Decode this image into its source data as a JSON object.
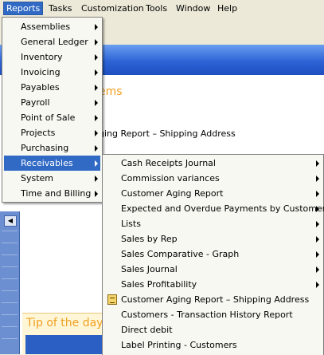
{
  "menubar": {
    "items": [
      "Reports",
      "Tasks",
      "Customization",
      "Tools",
      "Window",
      "Help"
    ],
    "active": "Reports"
  },
  "background": {
    "heading_fragment": "ems",
    "report_fragment": "ging Report – Shipping Address",
    "tip_title": "Tip of the day"
  },
  "reports_menu": {
    "items": [
      {
        "label": "Assemblies",
        "submenu": true
      },
      {
        "label": "General Ledger",
        "submenu": true
      },
      {
        "label": "Inventory",
        "submenu": true
      },
      {
        "label": "Invoicing",
        "submenu": true
      },
      {
        "label": "Payables",
        "submenu": true
      },
      {
        "label": "Payroll",
        "submenu": true
      },
      {
        "label": "Point of Sale",
        "submenu": true
      },
      {
        "label": "Projects",
        "submenu": true
      },
      {
        "label": "Purchasing",
        "submenu": true
      },
      {
        "label": "Receivables",
        "submenu": true,
        "highlighted": true
      },
      {
        "label": "System",
        "submenu": true
      },
      {
        "label": "Time and Billing",
        "submenu": true
      }
    ]
  },
  "receivables_menu": {
    "items": [
      {
        "label": "Cash Receipts Journal",
        "submenu": true
      },
      {
        "label": "Commission variances",
        "submenu": true
      },
      {
        "label": "Customer Aging Report",
        "submenu": true
      },
      {
        "label": "Expected and Overdue Payments by Customer",
        "submenu": true
      },
      {
        "label": "Lists",
        "submenu": true
      },
      {
        "label": "Sales by Rep",
        "submenu": true
      },
      {
        "label": "Sales Comparative - Graph",
        "submenu": true
      },
      {
        "label": "Sales Journal",
        "submenu": true
      },
      {
        "label": "Sales Profitability",
        "submenu": true
      },
      {
        "label": "Customer Aging Report – Shipping Address",
        "submenu": false,
        "icon": "report-icon"
      },
      {
        "label": "Customers - Transaction History Report",
        "submenu": false
      },
      {
        "label": "Direct debit",
        "submenu": false
      },
      {
        "label": "Label Printing - Customers",
        "submenu": false
      }
    ]
  }
}
